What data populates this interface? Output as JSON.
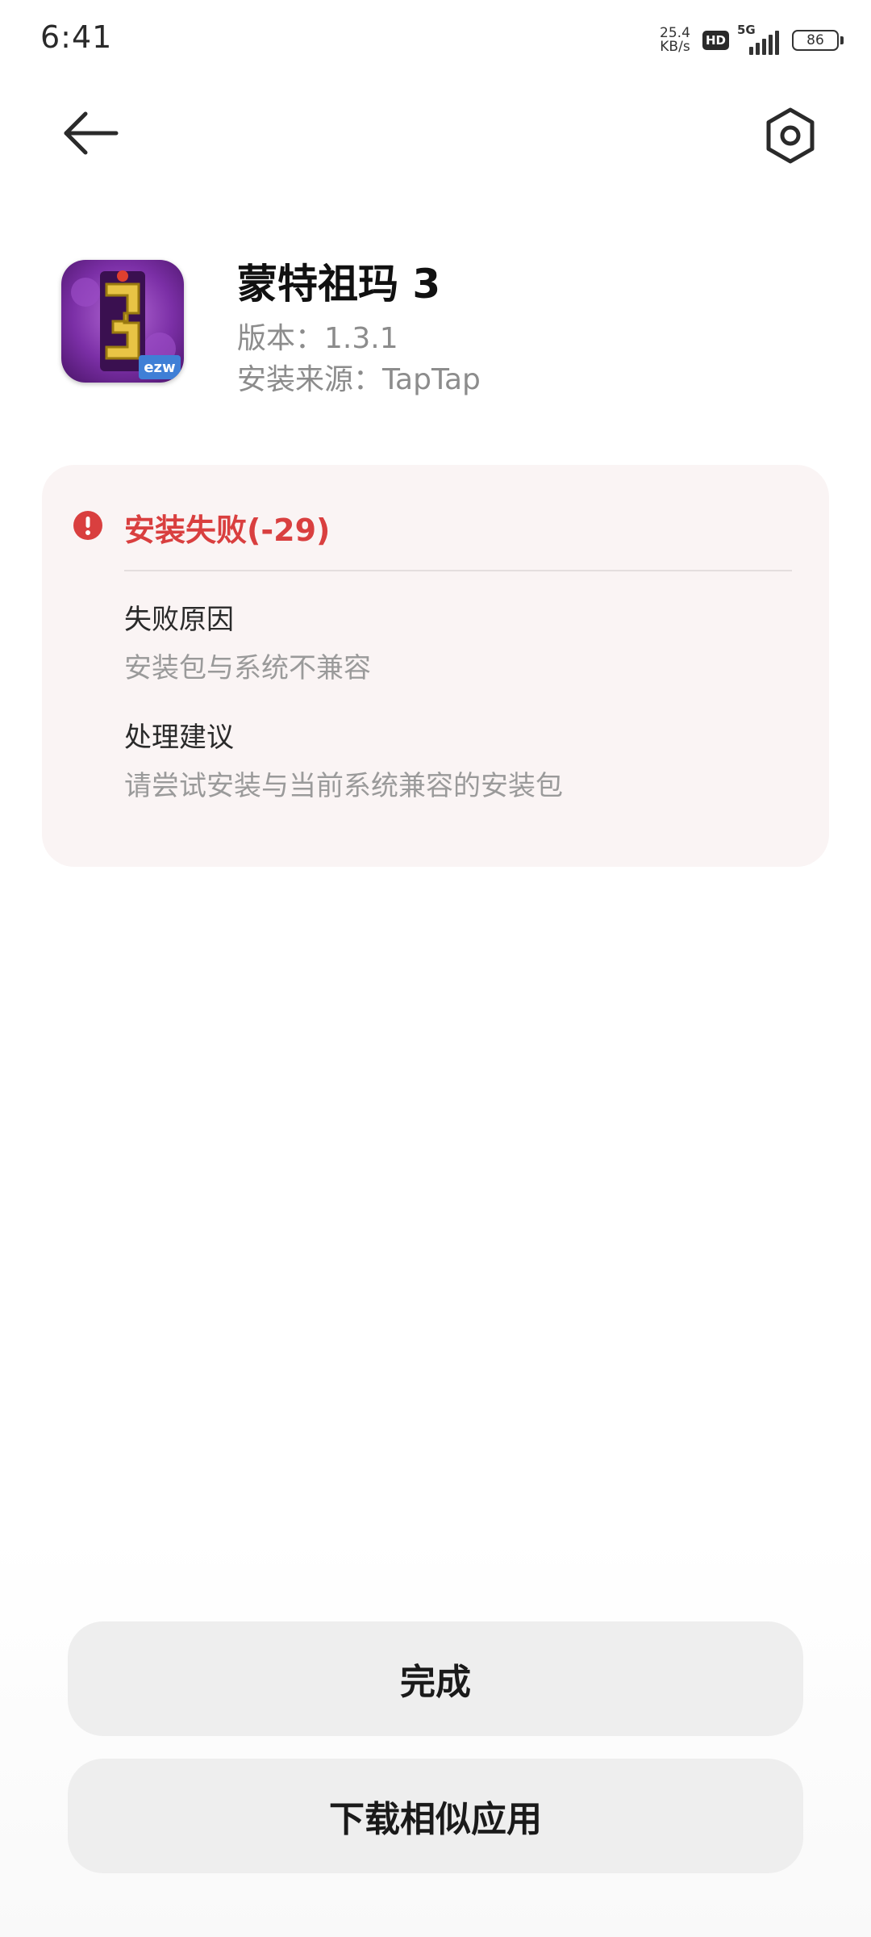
{
  "status_bar": {
    "time": "6:41",
    "net_speed_value": "25.4",
    "net_speed_unit": "KB/s",
    "hd_label": "HD",
    "network_label": "5G",
    "battery_level": "86"
  },
  "header": {
    "back_icon": "arrow-left-icon",
    "settings_icon": "hexagon-gear-icon"
  },
  "app": {
    "name": "蒙特祖玛 3",
    "version": "版本：1.3.1",
    "source": "安装来源：TapTap",
    "icon_badge": "ezw"
  },
  "error": {
    "icon": "exclamation-circle-icon",
    "title": "安装失败(-29)",
    "reason_label": "失败原因",
    "reason_text": "安装包与系统不兼容",
    "suggestion_label": "处理建议",
    "suggestion_text": "请尝试安装与当前系统兼容的安装包",
    "color": "#d93f3f"
  },
  "actions": {
    "done_label": "完成",
    "download_similar_label": "下载相似应用"
  }
}
